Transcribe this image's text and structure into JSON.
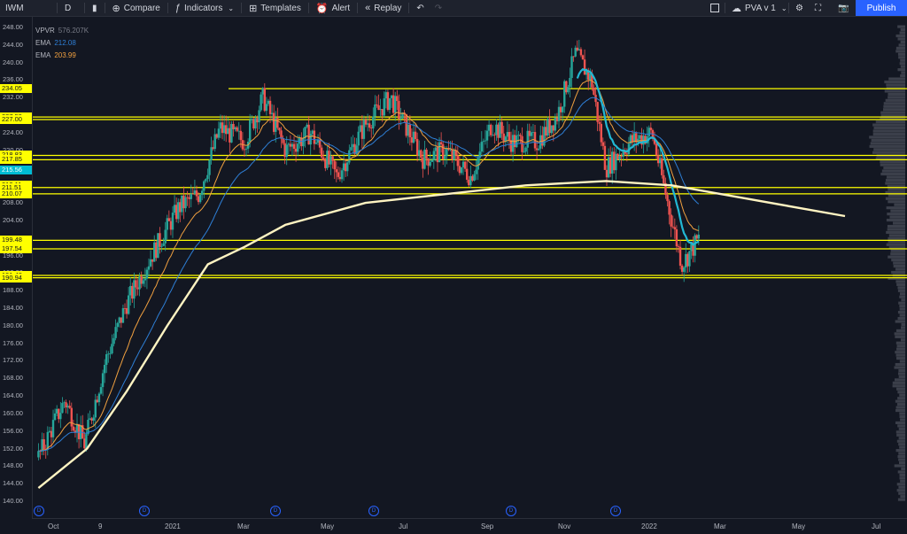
{
  "toolbar": {
    "symbol": "IWM",
    "interval": "D",
    "compare": "Compare",
    "indicators": "Indicators",
    "templates": "Templates",
    "alert": "Alert",
    "replay": "Replay",
    "layout_name": "PVA v 1",
    "publish": "Publish"
  },
  "legend": {
    "vpvr_label": "VPVR",
    "vpvr_value": "576.207K",
    "ema1_label": "EMA",
    "ema1_value": "212.08",
    "ema2_label": "EMA",
    "ema2_value": "203.99"
  },
  "colors": {
    "ema_fast": "#2e7fd6",
    "ema_slow": "#f0a040",
    "sma200": "#fff4c2",
    "ema_teal": "#22b8d4",
    "level": "#ffff00",
    "bull": "#26a69a",
    "bear": "#ef5350",
    "highlight": "#ffff00",
    "current": "#00bcd4"
  },
  "price_ticks": [
    "248.00",
    "244.00",
    "240.00",
    "236.00",
    "232.00",
    "228.00",
    "224.00",
    "220.00",
    "216.00",
    "212.00",
    "208.00",
    "204.00",
    "200.00",
    "196.00",
    "192.00",
    "188.00",
    "184.00",
    "180.00",
    "176.00",
    "172.00",
    "168.00",
    "164.00",
    "160.00",
    "156.00",
    "152.00",
    "148.00",
    "144.00",
    "140.00"
  ],
  "level_labels": [
    {
      "text": "234.05",
      "price": 234.05
    },
    {
      "text": "227.59",
      "price": 227.59
    },
    {
      "text": "227.00",
      "price": 227.0
    },
    {
      "text": "218.83",
      "price": 218.83
    },
    {
      "text": "217.85",
      "price": 217.85
    },
    {
      "text": "215.56",
      "price": 215.56,
      "current": true
    },
    {
      "text": "212.11",
      "price": 212.11
    },
    {
      "text": "211.51",
      "price": 211.51
    },
    {
      "text": "210.07",
      "price": 210.07
    },
    {
      "text": "199.48",
      "price": 199.48
    },
    {
      "text": "197.54",
      "price": 197.54
    },
    {
      "text": "191.48",
      "price": 191.48
    },
    {
      "text": "190.94",
      "price": 190.94
    }
  ],
  "time_ticks": [
    "Oct",
    "9",
    "2021",
    "Mar",
    "May",
    "Jul",
    "Sep",
    "Nov",
    "2022",
    "Mar",
    "May",
    "Jul"
  ],
  "dividend_marker": "D",
  "chart_data": {
    "type": "candlestick",
    "symbol": "IWM",
    "interval": "D",
    "y_range": [
      138,
      250
    ],
    "x_range": [
      "2020-09",
      "2022-07"
    ],
    "horizontal_levels": [
      234.05,
      227.59,
      227.0,
      218.83,
      217.85,
      211.51,
      210.07,
      199.48,
      197.54,
      191.48,
      190.94
    ],
    "close_path": [
      [
        "2020-09-25",
        150
      ],
      [
        "2020-10-15",
        163
      ],
      [
        "2020-10-30",
        153
      ],
      [
        "2020-11-15",
        172
      ],
      [
        "2020-12-01",
        185
      ],
      [
        "2020-12-20",
        196
      ],
      [
        "2021-01-10",
        207
      ],
      [
        "2021-01-25",
        210
      ],
      [
        "2021-02-10",
        225
      ],
      [
        "2021-03-01",
        222
      ],
      [
        "2021-03-15",
        232
      ],
      [
        "2021-04-01",
        220
      ],
      [
        "2021-04-20",
        224
      ],
      [
        "2021-05-10",
        214
      ],
      [
        "2021-06-01",
        226
      ],
      [
        "2021-06-20",
        232
      ],
      [
        "2021-07-15",
        218
      ],
      [
        "2021-08-01",
        220
      ],
      [
        "2021-08-20",
        214
      ],
      [
        "2021-09-05",
        226
      ],
      [
        "2021-09-20",
        222
      ],
      [
        "2021-10-10",
        222
      ],
      [
        "2021-10-25",
        228
      ],
      [
        "2021-11-08",
        242
      ],
      [
        "2021-11-20",
        236
      ],
      [
        "2021-12-01",
        216
      ],
      [
        "2021-12-20",
        222
      ],
      [
        "2022-01-05",
        224
      ],
      [
        "2022-01-20",
        204
      ],
      [
        "2022-01-28",
        194
      ],
      [
        "2022-02-10",
        200
      ]
    ],
    "sma200_path": [
      [
        "2020-09-25",
        143
      ],
      [
        "2020-11-01",
        152
      ],
      [
        "2020-12-01",
        165
      ],
      [
        "2021-01-01",
        180
      ],
      [
        "2021-02-01",
        194
      ],
      [
        "2021-03-01",
        198
      ],
      [
        "2021-04-01",
        203
      ],
      [
        "2021-06-01",
        208
      ],
      [
        "2021-08-01",
        210
      ],
      [
        "2021-10-01",
        212
      ],
      [
        "2021-12-01",
        213
      ],
      [
        "2022-01-20",
        212
      ],
      [
        "2022-06-01",
        205
      ]
    ]
  }
}
